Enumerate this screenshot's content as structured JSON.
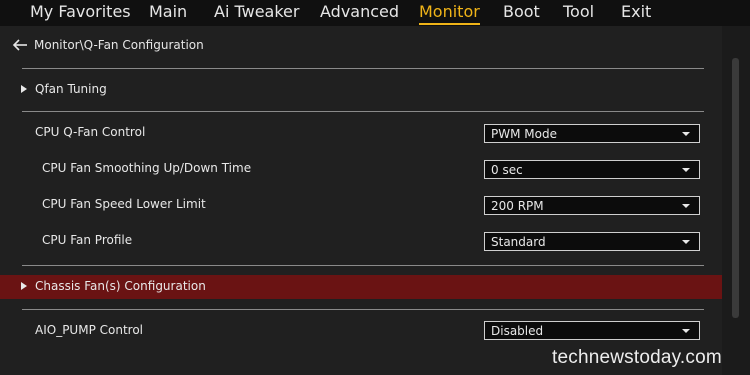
{
  "menu": {
    "tabs": [
      {
        "label": "My Favorites"
      },
      {
        "label": "Main"
      },
      {
        "label": "Ai Tweaker"
      },
      {
        "label": "Advanced"
      },
      {
        "label": "Monitor",
        "active": true
      },
      {
        "label": "Boot"
      },
      {
        "label": "Tool"
      },
      {
        "label": "Exit"
      }
    ]
  },
  "breadcrumb": {
    "path": "Monitor\\Q-Fan Configuration",
    "icon": "arrow-left-icon"
  },
  "sections": {
    "qfan_tuning": "Qfan Tuning",
    "chassis_fans": "Chassis Fan(s) Configuration"
  },
  "settings": [
    {
      "label": "CPU Q-Fan Control",
      "value": "PWM Mode"
    },
    {
      "label": "CPU Fan Smoothing Up/Down Time",
      "value": "0 sec"
    },
    {
      "label": "CPU Fan Speed Lower Limit",
      "value": "200 RPM"
    },
    {
      "label": "CPU Fan Profile",
      "value": "Standard"
    },
    {
      "label": "AIO_PUMP Control",
      "value": "Disabled"
    }
  ],
  "watermark": "technewstoday.com",
  "colors": {
    "accent": "#f0b418",
    "highlight_row": "#6a1313",
    "background": "#202020"
  }
}
